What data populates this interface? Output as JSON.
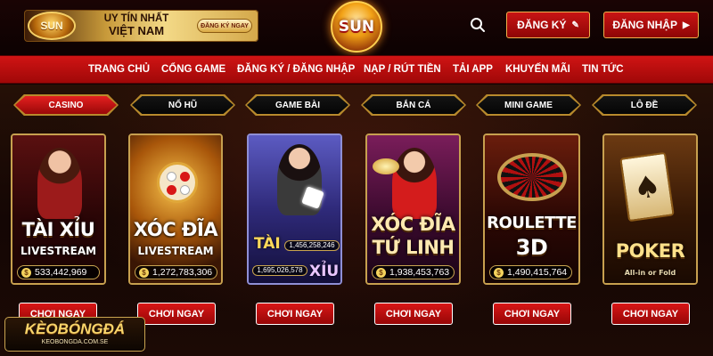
{
  "header": {
    "promo_line1": "UY TÍN NHẤT",
    "promo_line2": "VIỆT NAM",
    "promo_button": "ĐĂNG KÝ NGAY",
    "promo_logo_text": "SUN",
    "logo_text": "SUN",
    "search_icon": "search-icon",
    "register_label": "ĐĂNG KÝ",
    "register_icon": "pencil-icon",
    "login_label": "ĐĂNG NHẬP",
    "login_icon": "arrow-right-icon"
  },
  "nav": {
    "items": [
      {
        "label": "TRANG CHỦ"
      },
      {
        "label": "CỔNG GAME"
      },
      {
        "label": "ĐĂNG KÝ / ĐĂNG NHẬP"
      },
      {
        "label": "NẠP / RÚT TIỀN"
      },
      {
        "label": "TẢI APP"
      },
      {
        "label": "KHUYẾN MÃI"
      },
      {
        "label": "TIN TỨC"
      }
    ]
  },
  "tabs": [
    {
      "label": "CASINO",
      "active": true
    },
    {
      "label": "NỔ HŨ",
      "active": false
    },
    {
      "label": "GAME BÀI",
      "active": false
    },
    {
      "label": "BẮN CÁ",
      "active": false
    },
    {
      "label": "MINI GAME",
      "active": false
    },
    {
      "label": "LÔ ĐỀ",
      "active": false
    }
  ],
  "cards": [
    {
      "title": "TÀI XỈU",
      "subtitle": "LIVESTREAM",
      "jackpot": "533,442,969"
    },
    {
      "title": "XÓC ĐĨA",
      "subtitle": "LIVESTREAM",
      "jackpot": "1,272,783,306"
    },
    {
      "title_left": "TÀI",
      "title_right": "XỈU",
      "jackpot_tai": "1,456,258,246",
      "jackpot_xiu": "1,695,026,578"
    },
    {
      "title": "XÓC ĐĨA",
      "subtitle": "TỨ LINH",
      "jackpot": "1,938,453,763"
    },
    {
      "title": "ROULETTE",
      "subtitle": "3D",
      "jackpot": "1,490,415,764"
    },
    {
      "title": "POKER",
      "subtitle": "All-in or Fold"
    }
  ],
  "play_label": "CHƠI NGAY",
  "watermark": {
    "main": "KÈOBÓNGĐÁ",
    "sub": "KEOBONGDA.COM.SE"
  },
  "colors": {
    "accent_red": "#c81414",
    "gold_border": "#c7a04f",
    "background": "#120303"
  }
}
